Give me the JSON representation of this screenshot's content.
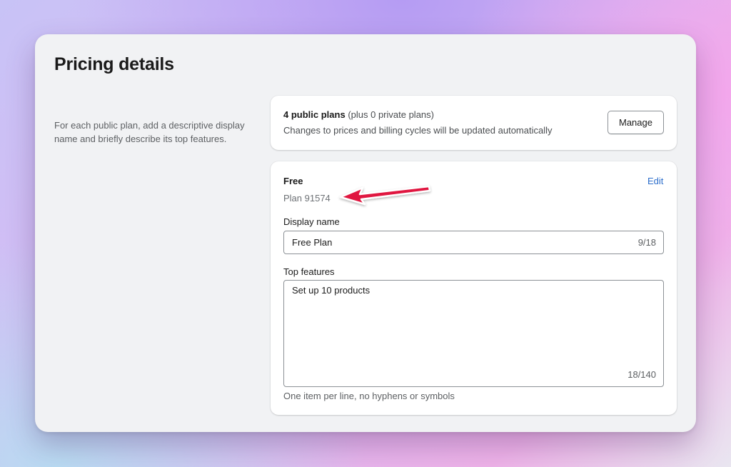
{
  "page": {
    "title": "Pricing details",
    "description": "For each public plan, add a descriptive display name and briefly describe its top features."
  },
  "plans_summary": {
    "public_count": "4 public plans",
    "private_count": "(plus 0 private plans)",
    "note": "Changes to prices and billing cycles will be updated automatically",
    "manage_label": "Manage"
  },
  "plan": {
    "name": "Free",
    "id": "Plan 91574",
    "edit_label": "Edit",
    "display_name": {
      "label": "Display name",
      "value": "Free Plan",
      "count": "9/18"
    },
    "top_features": {
      "label": "Top features",
      "value": "Set up 10 products",
      "count": "18/140",
      "help": "One item per line, no hyphens or symbols"
    }
  },
  "colors": {
    "link": "#2c6ecb",
    "annotation_arrow": "#e0173f",
    "window_background": "#f1f2f4"
  },
  "icons": {
    "annotation": "red-arrow-icon"
  }
}
